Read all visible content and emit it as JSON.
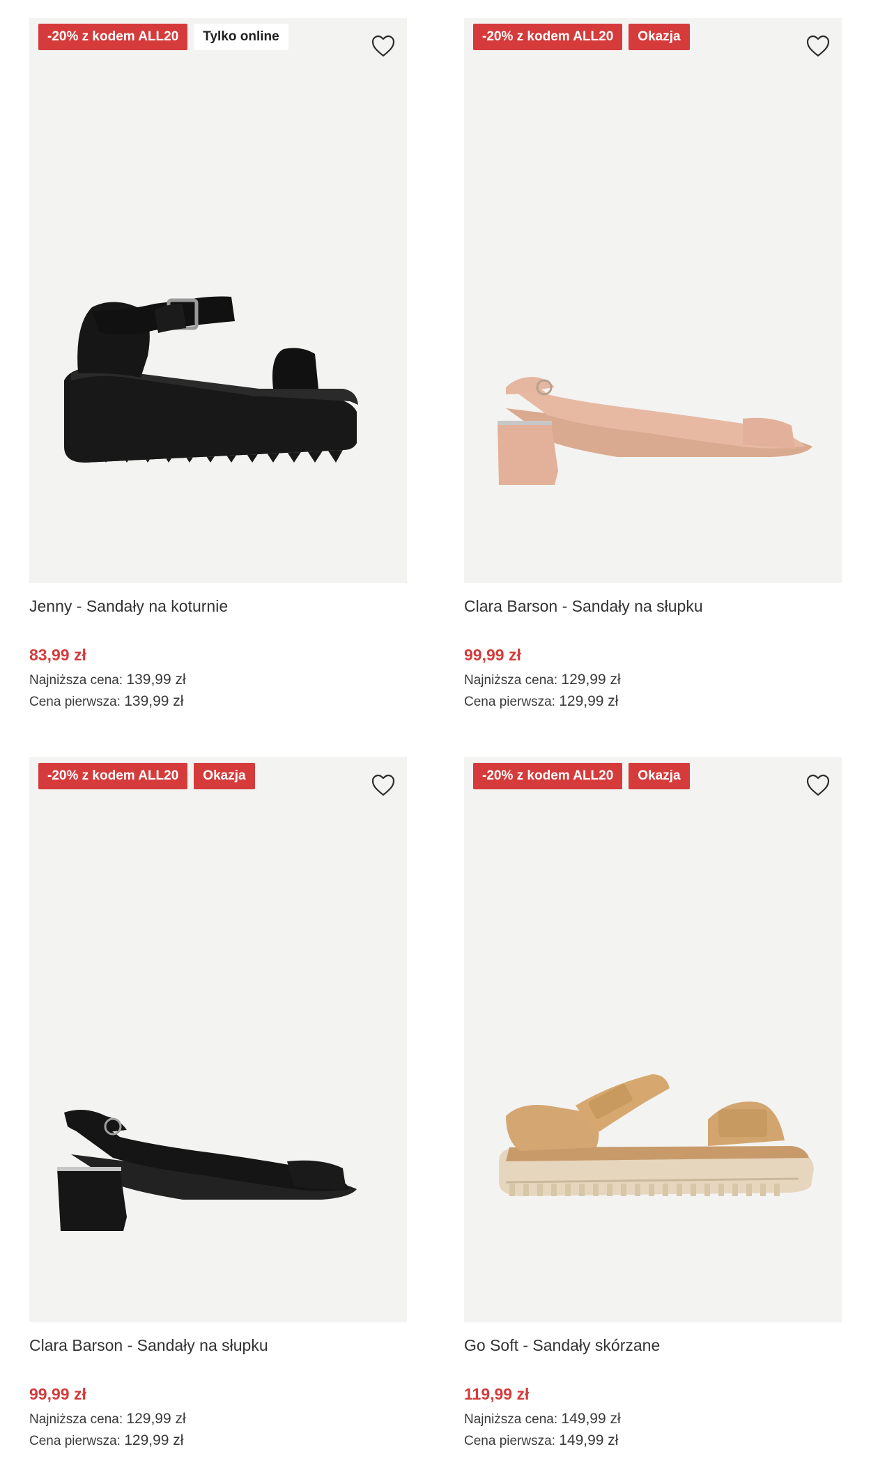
{
  "products": [
    {
      "badges": [
        {
          "text": "-20% z kodem ALL20",
          "kind": "promo"
        },
        {
          "text": "Tylko online",
          "kind": "online"
        }
      ],
      "name": "Jenny - Sandały na koturnie",
      "price": "83,99 zł",
      "lowest_label": "Najniższa cena:",
      "lowest_value": "139,99 zł",
      "first_label": "Cena pierwsza:",
      "first_value": "139,99 zł",
      "image_icon": "black-platform-sandal"
    },
    {
      "badges": [
        {
          "text": "-20% z kodem ALL20",
          "kind": "promo"
        },
        {
          "text": "Okazja",
          "kind": "deal"
        }
      ],
      "name": "Clara Barson - Sandały na słupku",
      "price": "99,99 zł",
      "lowest_label": "Najniższa cena:",
      "lowest_value": "129,99 zł",
      "first_label": "Cena pierwsza:",
      "first_value": "129,99 zł",
      "image_icon": "beige-slingback-sandal"
    },
    {
      "badges": [
        {
          "text": "-20% z kodem ALL20",
          "kind": "promo"
        },
        {
          "text": "Okazja",
          "kind": "deal"
        }
      ],
      "name": "Clara Barson - Sandały na słupku",
      "price": "99,99 zł",
      "lowest_label": "Najniższa cena:",
      "lowest_value": "129,99 zł",
      "first_label": "Cena pierwsza:",
      "first_value": "129,99 zł",
      "image_icon": "black-slingback-sandal"
    },
    {
      "badges": [
        {
          "text": "-20% z kodem ALL20",
          "kind": "promo"
        },
        {
          "text": "Okazja",
          "kind": "deal"
        }
      ],
      "name": "Go Soft - Sandały skórzane",
      "price": "119,99 zł",
      "lowest_label": "Najniższa cena:",
      "lowest_value": "149,99 zł",
      "first_label": "Cena pierwsza:",
      "first_value": "149,99 zł",
      "image_icon": "tan-sport-sandal"
    }
  ],
  "colors": {
    "accent_red": "#d53b3b",
    "card_bg": "#f3f3f2",
    "text": "#333333"
  },
  "icons": {
    "favorite": "heart-outline-icon"
  }
}
